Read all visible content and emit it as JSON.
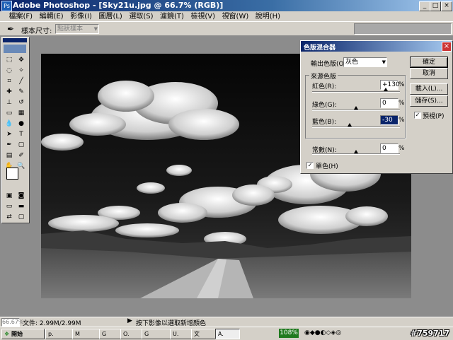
{
  "window": {
    "title": "Adobe Photoshop - [Sky21u.jpg @ 66.7% (RGB)]",
    "controls": [
      "_",
      "□",
      "×"
    ]
  },
  "menubar": {
    "items": [
      "檔案(F)",
      "編輯(E)",
      "影像(I)",
      "圖層(L)",
      "選取(S)",
      "濾鏡(T)",
      "檢視(V)",
      "視窗(W)",
      "說明(H)"
    ]
  },
  "options_bar": {
    "sample_size_label": "樣本尺寸:",
    "sample_size_value": "點狀樣本"
  },
  "dialog": {
    "title": "色版混合器",
    "output_channel_label": "輸出色版(O):",
    "output_channel_value": "灰色",
    "source_group_label": "來源色版",
    "red_label": "紅色(R):",
    "red_value": "+130",
    "green_label": "綠色(G):",
    "green_value": "0",
    "blue_label": "藍色(B):",
    "blue_value": "-30",
    "constant_label": "常數(N):",
    "constant_value": "0",
    "percent": "%",
    "monochrome_label": "單色(H)",
    "preview_label": "預視(P)",
    "ok_label": "確定",
    "cancel_label": "取消",
    "load_label": "載入(L)...",
    "save_label": "儲存(S)...",
    "levels": {
      "red": 130,
      "green": 0,
      "blue": -30,
      "constant": 0
    }
  },
  "statusbar": {
    "zoom": "66.67%",
    "doc_info": "文件: 2.99M/2.99M",
    "hint": "按下影像以選取新增顏色"
  },
  "taskbar": {
    "start_label": "開始",
    "tasks": [
      "p.",
      "M",
      "G",
      "O.",
      "G",
      "U.",
      "文",
      "A."
    ],
    "tray_value": "108%",
    "watermark": "#759717"
  }
}
